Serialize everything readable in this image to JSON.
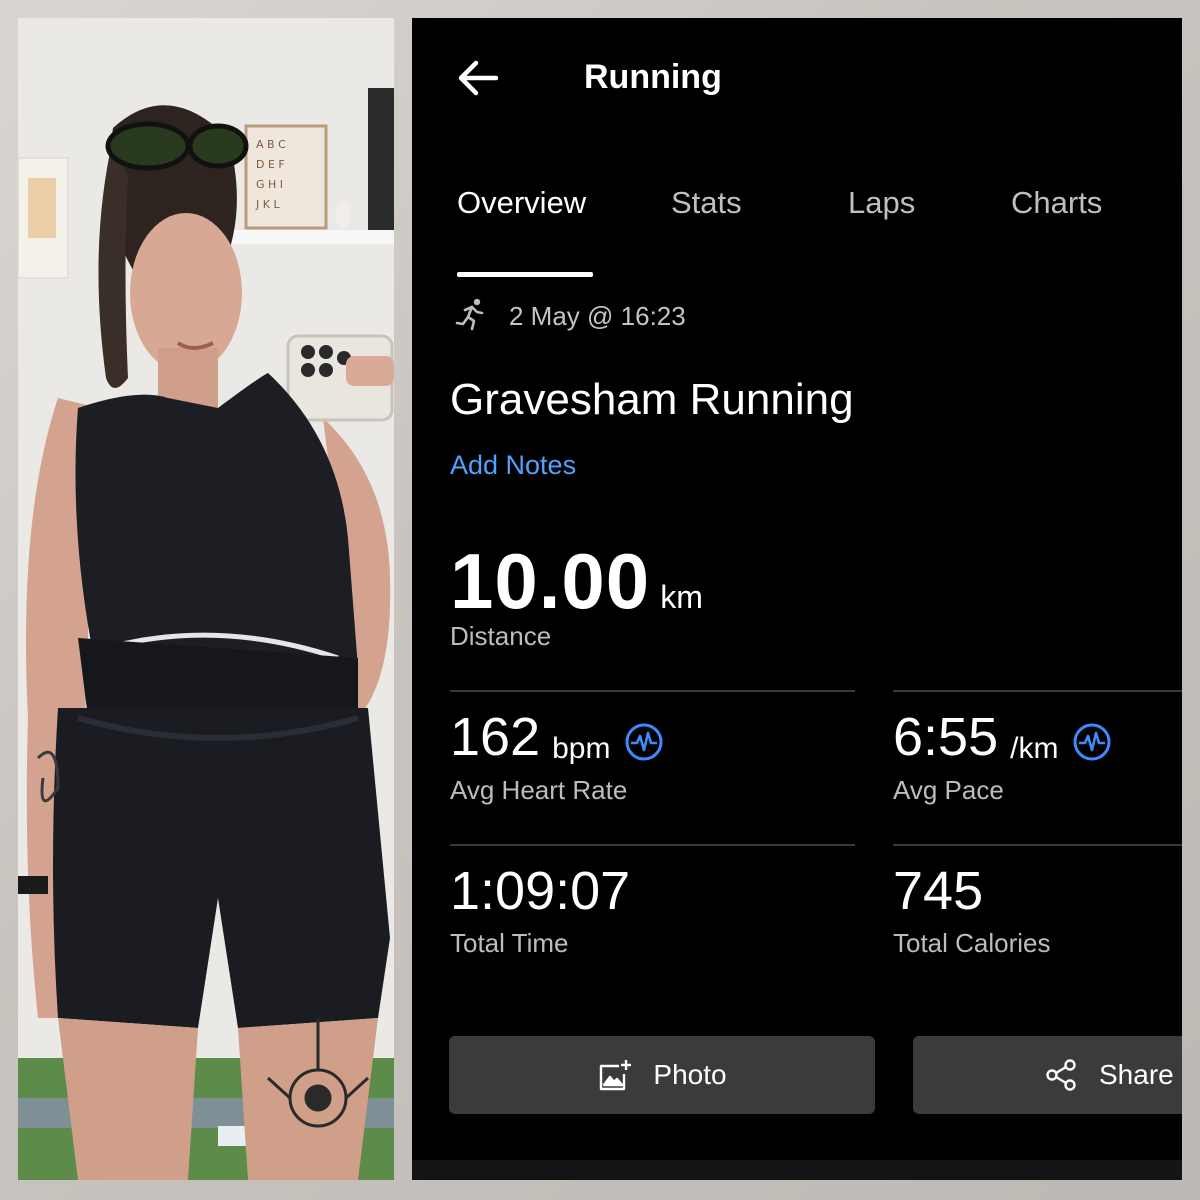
{
  "app": {
    "title": "Running",
    "tabs": [
      {
        "label": "Overview",
        "active": true
      },
      {
        "label": "Stats",
        "active": false
      },
      {
        "label": "Laps",
        "active": false
      },
      {
        "label": "Charts",
        "active": false
      }
    ]
  },
  "activity": {
    "icon": "running-person-icon",
    "date": "2 May @ 16:23",
    "name": "Gravesham Running",
    "add_notes": "Add Notes"
  },
  "distance": {
    "value": "10.00",
    "unit": "km",
    "label": "Distance"
  },
  "metrics": {
    "heart_rate": {
      "value": "162",
      "unit": "bpm",
      "label": "Avg Heart Rate",
      "icon": "pulse-icon"
    },
    "pace": {
      "value": "6:55",
      "unit": "/km",
      "label": "Avg Pace",
      "icon": "pulse-icon"
    },
    "time": {
      "value": "1:09:07",
      "label": "Total Time"
    },
    "calories": {
      "value": "745",
      "label": "Total Calories"
    }
  },
  "actions": {
    "photo_label": "Photo",
    "share_label": "Share"
  },
  "colors": {
    "background": "#000000",
    "accent_link": "#4da3ff",
    "pulse_icon": "#3d8bff",
    "button_bg": "#3b3b3b"
  }
}
